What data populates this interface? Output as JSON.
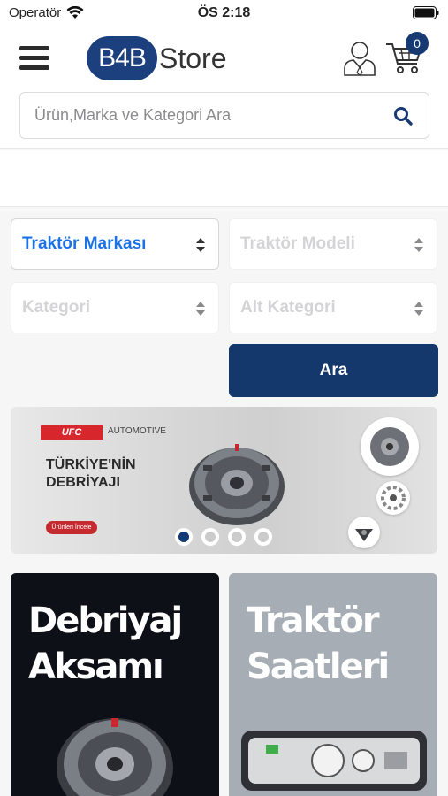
{
  "status_bar": {
    "carrier": "Operatör",
    "time": "ÖS 2:18"
  },
  "header": {
    "logo_primary": "B4B",
    "logo_secondary": "Store",
    "cart_count": "0",
    "search_placeholder": "Ürün,Marka ve Kategori Ara"
  },
  "filters": {
    "brand": "Traktör Markası",
    "model": "Traktör Modeli",
    "category": "Kategori",
    "subcategory": "Alt Kategori",
    "search_button": "Ara"
  },
  "banner": {
    "brand": "UFC",
    "brand_suffix": "AUTOMOTIVE",
    "headline_line1": "TÜRKİYE'NİN",
    "headline_line2": "DEBRİYAJI",
    "cta": "Ürünleri İncele",
    "slide_count": 4,
    "active_slide": 1
  },
  "categories": [
    {
      "line1": "Debriyaj",
      "line2": "Aksamı"
    },
    {
      "line1": "Traktör",
      "line2": "Saatleri"
    }
  ],
  "colors": {
    "brand_navy": "#15386c",
    "link_blue": "#1b72e8",
    "accent_red": "#d7262c"
  }
}
